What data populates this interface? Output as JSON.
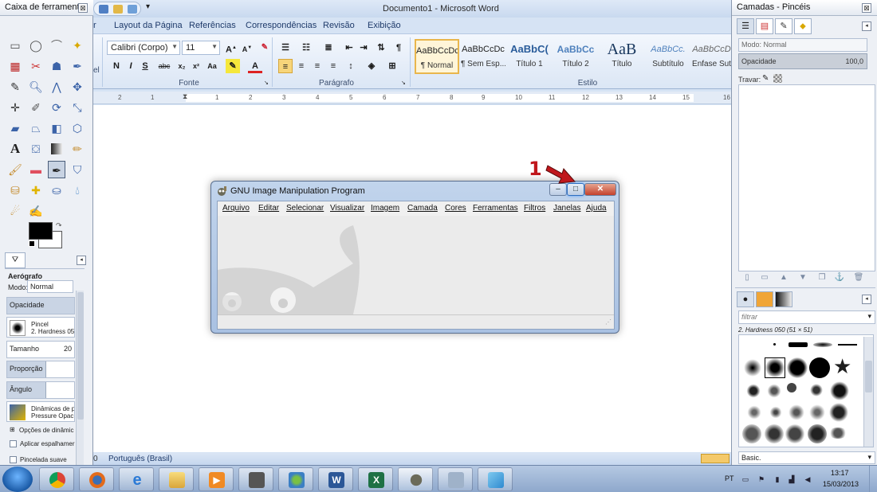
{
  "word": {
    "title": "Documento1 - Microsoft Word",
    "tabs": [
      "Layout da Página",
      "Referências",
      "Correspondências",
      "Revisão",
      "Exibição"
    ],
    "font_name": "Calibri (Corpo)",
    "font_size": "11",
    "groups": [
      "Fonte",
      "Parágrafo",
      "Estilo"
    ],
    "styles": [
      {
        "preview": "AaBbCcDc",
        "label": "¶ Normal"
      },
      {
        "preview": "AaBbCcDc",
        "label": "¶ Sem Esp..."
      },
      {
        "preview": "AaBbC(",
        "label": "Título 1"
      },
      {
        "preview": "AaBbCc",
        "label": "Título 2"
      },
      {
        "preview": "AaB",
        "label": "Título"
      },
      {
        "preview": "AaBbCc.",
        "label": "Subtítulo"
      },
      {
        "preview": "AaBbCcD",
        "label": "Ênfase Sut"
      }
    ],
    "ruler_numbers": [
      "2",
      "1",
      "1",
      "2",
      "3",
      "4",
      "5",
      "6",
      "7",
      "8",
      "9",
      "10",
      "11",
      "12",
      "13",
      "14",
      "15",
      "16"
    ],
    "status_page": "0",
    "status_language": "Português (Brasil)",
    "partial_tab": "r",
    "partial_group_label": "el"
  },
  "toolbox": {
    "title": "Caixa de ferrament...",
    "close": "⊠",
    "tool_name": "Aerógrafo",
    "mode_label": "Modo:",
    "mode_value": "Normal",
    "opacity_label": "Opacidade",
    "brush_label": "Pincel",
    "brush_value": "2. Hardness 050",
    "size_label": "Tamanho",
    "size_value": "20",
    "ratio_label": "Proporção",
    "angle_label": "Ângulo",
    "dynamics_label": "Dinâmicas de p",
    "dynamics_value": "Pressure Opac",
    "dynamics_options": "Opções de dinâmic",
    "apply_jitter": "Aplicar espalhamer",
    "smooth_stroke": "Pincelada suave"
  },
  "layers": {
    "title": "Camadas - Pincéis",
    "close": "⊠",
    "mode_label": "Modo: Normal",
    "opacity_label": "Opacidade",
    "opacity_value": "100,0",
    "lock_label": "Travar:",
    "filter_placeholder": "filtrar",
    "brush_name": "2. Hardness 050 (51 × 51)",
    "brush_set": "Basic."
  },
  "gimp": {
    "title": "GNU Image Manipulation Program",
    "menus": [
      "Arquivo",
      "Editar",
      "Selecionar",
      "Visualizar",
      "Imagem",
      "Camada",
      "Cores",
      "Ferramentas",
      "Filtros",
      "Janelas",
      "Ajuda"
    ],
    "minimize": "–",
    "maximize": "□",
    "close": "✕"
  },
  "annotation": {
    "number": "1",
    "color": "#c0171c"
  },
  "taskbar": {
    "apps": [
      "Chrome",
      "Firefox",
      "Internet Explorer",
      "Windows Explorer",
      "Media Player",
      "Webcam",
      "Network",
      "Word",
      "Excel",
      "GIMP",
      "Unknown",
      "Paint"
    ],
    "language": "PT",
    "time": "13:17",
    "date": "15/03/2013"
  }
}
